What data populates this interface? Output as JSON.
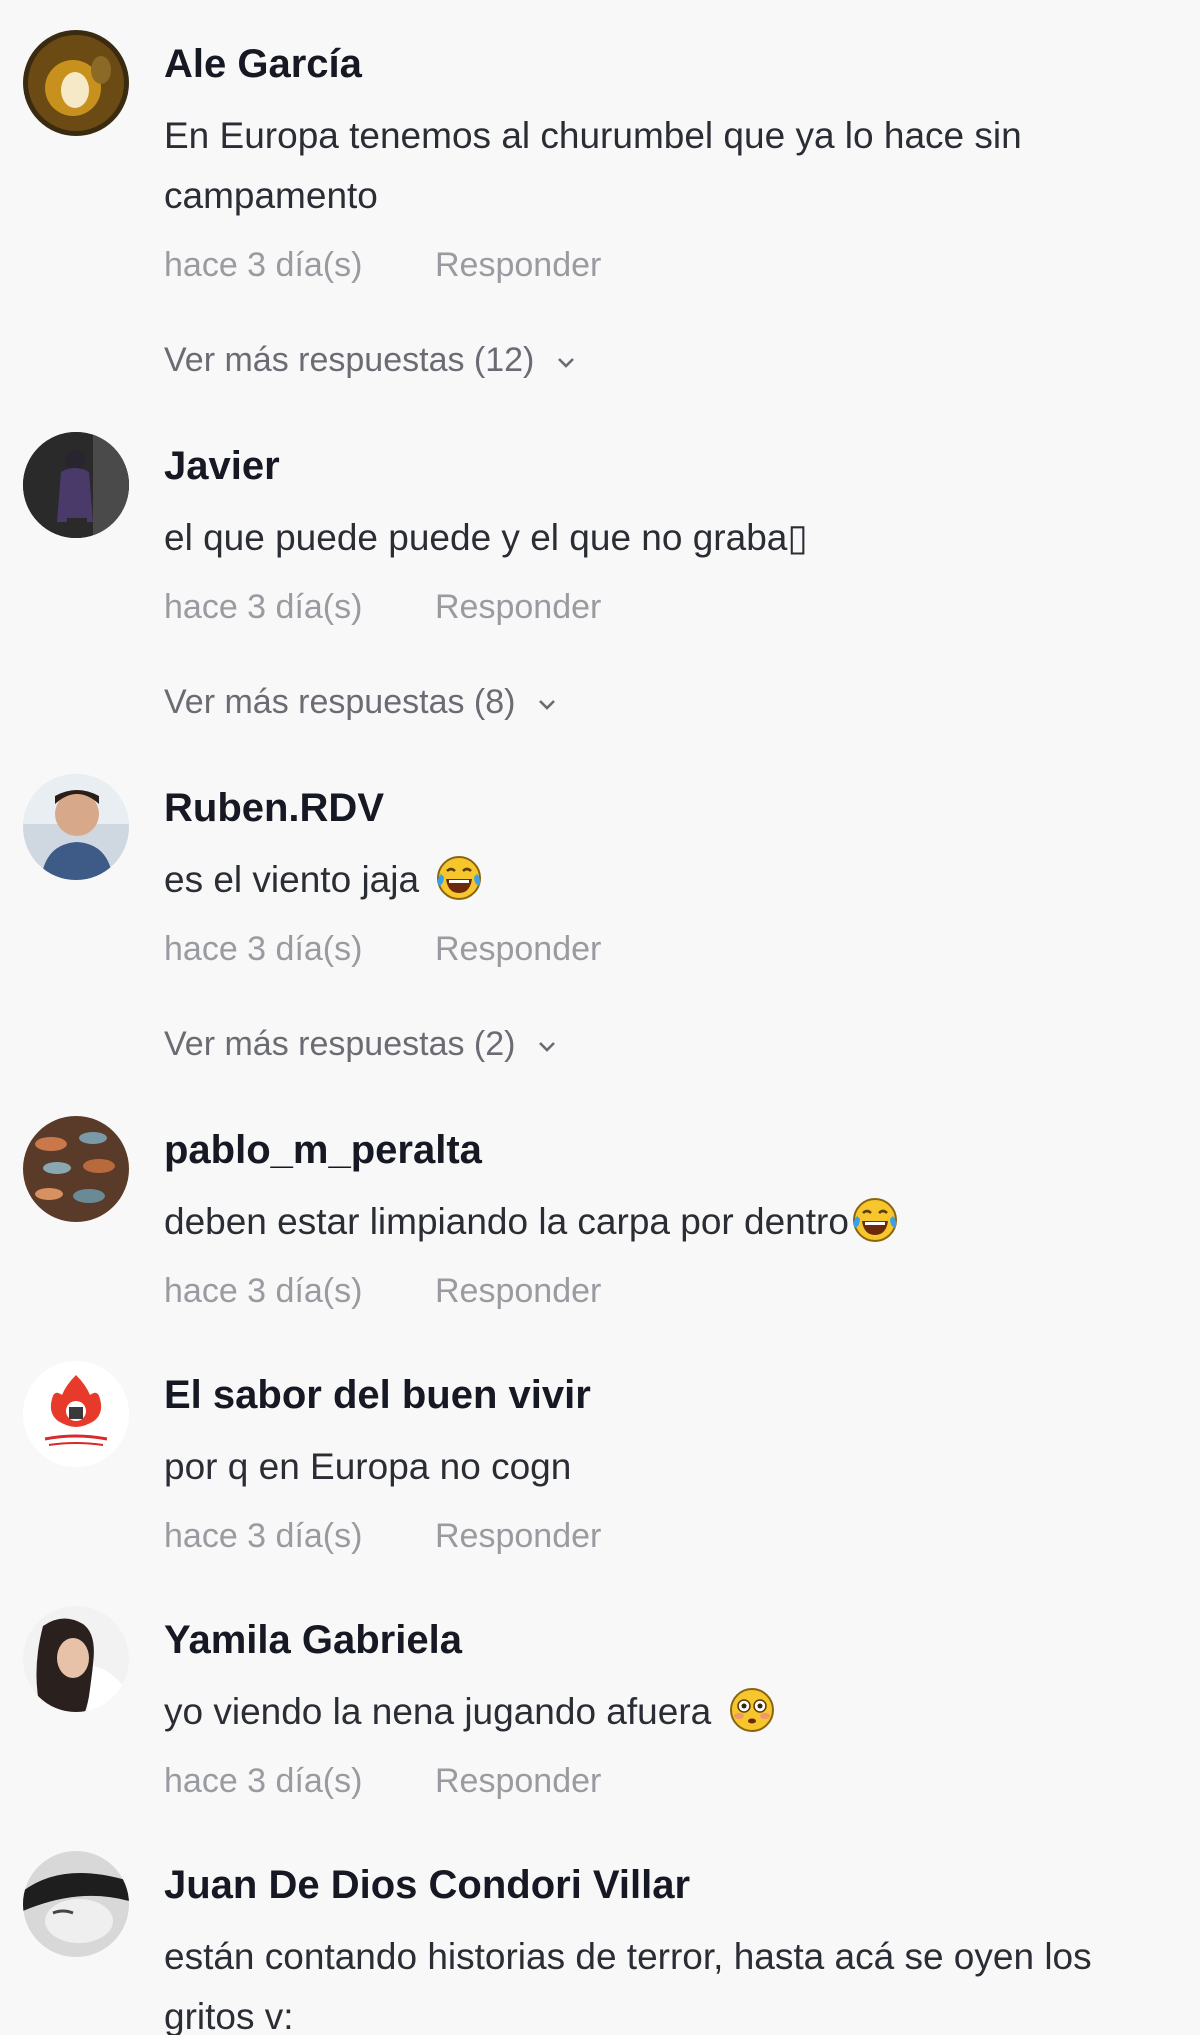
{
  "comments": [
    {
      "username": "Ale García",
      "text": "En Europa tenemos al churumbel que ya lo hace sin campamento",
      "time": "hace 3 día(s)",
      "reply": "Responder",
      "more_replies": "Ver más respuestas (12)"
    },
    {
      "username": "Javier",
      "text": "el que puede puede y el que no graba▯",
      "time": "hace 3 día(s)",
      "reply": "Responder",
      "more_replies": "Ver más respuestas (8)"
    },
    {
      "username": "Ruben.RDV",
      "text": "es el viento jaja",
      "emoji": "face-with-tears-of-joy",
      "time": "hace 3 día(s)",
      "reply": "Responder",
      "more_replies": "Ver más respuestas (2)"
    },
    {
      "username": "pablo_m_peralta",
      "text": "deben estar limpiando la carpa por dentro",
      "emoji": "face-with-tears-of-joy",
      "time": "hace 3 día(s)",
      "reply": "Responder"
    },
    {
      "username": "El sabor del buen vivir",
      "text": "por q en Europa no cogn",
      "time": "hace 3 día(s)",
      "reply": "Responder"
    },
    {
      "username": "Yamila Gabriela",
      "text": "yo viendo la nena jugando afuera",
      "emoji": "flushed-face",
      "time": "hace 3 día(s)",
      "reply": "Responder"
    },
    {
      "username": "Juan De Dios Condori Villar",
      "text": "están contando historias de terror, hasta acá se oyen los gritos v:"
    }
  ],
  "colors": {
    "background": "#f8f8f8",
    "username": "#161823",
    "text": "#2b2d35",
    "meta": "#9a9ba1",
    "more_replies": "#6b6c73"
  }
}
